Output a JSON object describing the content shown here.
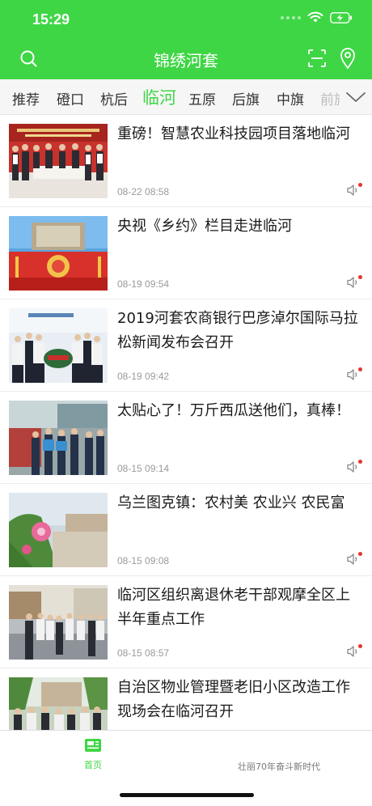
{
  "status_bar": {
    "time": "15:29"
  },
  "header": {
    "title": "锦绣河套",
    "icons": [
      "search-icon",
      "scan-icon",
      "location-icon"
    ]
  },
  "tabs": [
    {
      "label": "推荐"
    },
    {
      "label": "磴口"
    },
    {
      "label": "杭后"
    },
    {
      "label": "临河",
      "active": true
    },
    {
      "label": "五原"
    },
    {
      "label": "后旗"
    },
    {
      "label": "中旗"
    },
    {
      "label": "前旗"
    }
  ],
  "news": [
    {
      "title": "重磅！智慧农业科技园项目落地临河",
      "time": "08-22 08:58"
    },
    {
      "title": "央视《乡约》栏目走进临河",
      "time": "08-19 09:54"
    },
    {
      "title": "2019河套农商银行巴彦淖尔国际马拉松新闻发布会召开",
      "time": "08-19 09:42"
    },
    {
      "title": "太贴心了！万斤西瓜送他们，真棒！",
      "time": "08-15 09:14"
    },
    {
      "title": "乌兰图克镇：农村美 农业兴 农民富",
      "time": "08-15 09:08"
    },
    {
      "title": "临河区组织离退休老干部观摩全区上半年重点工作",
      "time": "08-15 08:57"
    },
    {
      "title": "自治区物业管理暨老旧小区改造工作现场会在临河召开",
      "time": ""
    }
  ],
  "bottom_tabs": [
    {
      "label": "首页",
      "active": true
    },
    {
      "label": "壮丽70年奋斗新时代"
    }
  ],
  "colors": {
    "accent": "#3fd645",
    "badge": "#e5352d"
  }
}
